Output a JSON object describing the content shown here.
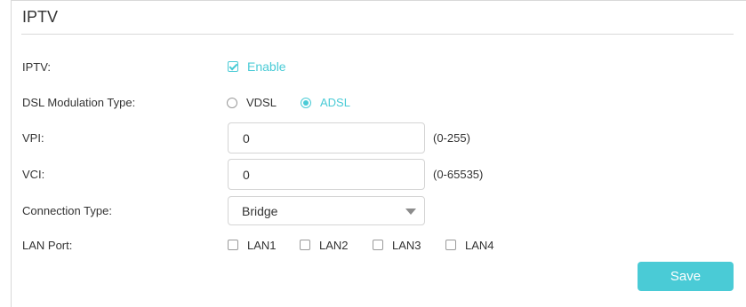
{
  "section": {
    "title": "IPTV"
  },
  "iptv": {
    "label": "IPTV:",
    "enable_label": "Enable",
    "enabled": true
  },
  "dsl": {
    "label": "DSL Modulation Type:",
    "options": [
      {
        "label": "VDSL",
        "selected": false
      },
      {
        "label": "ADSL",
        "selected": true
      }
    ]
  },
  "vpi": {
    "label": "VPI:",
    "value": "0",
    "hint": "(0-255)"
  },
  "vci": {
    "label": "VCI:",
    "value": "0",
    "hint": "(0-65535)"
  },
  "connection": {
    "label": "Connection Type:",
    "selected": "Bridge"
  },
  "lan": {
    "label": "LAN Port:",
    "ports": [
      {
        "label": "LAN1",
        "checked": false
      },
      {
        "label": "LAN2",
        "checked": false
      },
      {
        "label": "LAN3",
        "checked": false
      },
      {
        "label": "LAN4",
        "checked": false
      }
    ]
  },
  "save_label": "Save",
  "colors": {
    "accent": "#4acbd6",
    "text": "#333333",
    "border": "#d4d4d4"
  }
}
